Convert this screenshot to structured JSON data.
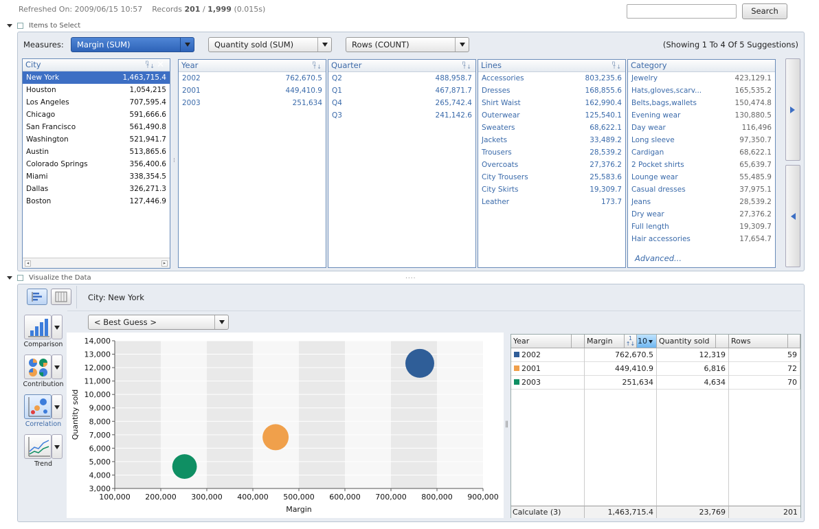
{
  "header": {
    "refreshed_label": "Refreshed On:",
    "refreshed_value": "2009/06/15 10:57",
    "records_label": "Records",
    "records_shown": "201",
    "records_sep": "/",
    "records_total": "1,999",
    "records_time": "(0.015s)",
    "search_placeholder": "",
    "search_button": "Search"
  },
  "items_section": {
    "title": "Items to Select",
    "measures_label": "Measures:",
    "measures": [
      {
        "label": "Margin (SUM)",
        "selected": true
      },
      {
        "label": "Quantity sold (SUM)",
        "selected": false
      },
      {
        "label": "Rows (COUNT)",
        "selected": false
      }
    ],
    "showing_text": "(Showing 1 To 4 Of 5 Suggestions)",
    "facets": {
      "city": {
        "title": "City",
        "rows": [
          {
            "name": "New York",
            "value": "1,463,715.4"
          },
          {
            "name": "Houston",
            "value": "1,054,215"
          },
          {
            "name": "Los Angeles",
            "value": "707,595.4"
          },
          {
            "name": "Chicago",
            "value": "591,666.6"
          },
          {
            "name": "San Francisco",
            "value": "561,490.8"
          },
          {
            "name": "Washington",
            "value": "521,941.7"
          },
          {
            "name": "Austin",
            "value": "513,865.6"
          },
          {
            "name": "Colorado Springs",
            "value": "356,400.6"
          },
          {
            "name": "Miami",
            "value": "338,354.5"
          },
          {
            "name": "Dallas",
            "value": "326,271.3"
          },
          {
            "name": "Boston",
            "value": "127,446.9"
          }
        ]
      },
      "year": {
        "title": "Year",
        "rows": [
          {
            "name": "2002",
            "value": "762,670.5"
          },
          {
            "name": "2001",
            "value": "449,410.9"
          },
          {
            "name": "2003",
            "value": "251,634"
          }
        ]
      },
      "quarter": {
        "title": "Quarter",
        "rows": [
          {
            "name": "Q2",
            "value": "488,958.7"
          },
          {
            "name": "Q1",
            "value": "467,871.7"
          },
          {
            "name": "Q4",
            "value": "265,742.4"
          },
          {
            "name": "Q3",
            "value": "241,142.6"
          }
        ]
      },
      "lines": {
        "title": "Lines",
        "rows": [
          {
            "name": "Accessories",
            "value": "803,235.6"
          },
          {
            "name": "Dresses",
            "value": "168,855.6"
          },
          {
            "name": "Shirt Waist",
            "value": "162,990.4"
          },
          {
            "name": "Outerwear",
            "value": "125,540.1"
          },
          {
            "name": "Sweaters",
            "value": "68,622.1"
          },
          {
            "name": "Jackets",
            "value": "33,489.2"
          },
          {
            "name": "Trousers",
            "value": "28,539.2"
          },
          {
            "name": "Overcoats",
            "value": "27,376.2"
          },
          {
            "name": "City Trousers",
            "value": "25,583.6"
          },
          {
            "name": "City Skirts",
            "value": "19,309.7"
          },
          {
            "name": "Leather",
            "value": "173.7"
          }
        ]
      },
      "category": {
        "title": "Category",
        "rows": [
          {
            "name": "Jewelry",
            "value": "423,129.1"
          },
          {
            "name": "Hats,gloves,scarv...",
            "value": "165,535.2"
          },
          {
            "name": "Belts,bags,wallets",
            "value": "150,474.8"
          },
          {
            "name": "Evening wear",
            "value": "130,880.5"
          },
          {
            "name": "Day wear",
            "value": "116,496"
          },
          {
            "name": "Long sleeve",
            "value": "97,350.7"
          },
          {
            "name": "Cardigan",
            "value": "68,622.1"
          },
          {
            "name": "2 Pocket shirts",
            "value": "65,639.7"
          },
          {
            "name": "Lounge wear",
            "value": "55,485.9"
          },
          {
            "name": "Casual dresses",
            "value": "37,975.1"
          },
          {
            "name": "Jeans",
            "value": "28,539.2"
          },
          {
            "name": "Dry wear",
            "value": "27,376.2"
          },
          {
            "name": "Full length",
            "value": "19,309.7"
          },
          {
            "name": "Hair accessories",
            "value": "17,654.7"
          }
        ],
        "advanced_link": "Advanced..."
      }
    }
  },
  "viz_section": {
    "title": "Visualize the Data",
    "filter_text": "City: New York",
    "best_guess": "< Best Guess >",
    "chart_types": [
      {
        "label": "Comparison",
        "icon": "bar-chart-icon"
      },
      {
        "label": "Contribution",
        "icon": "pie-chart-icon"
      },
      {
        "label": "Correlation",
        "icon": "bubble-chart-icon"
      },
      {
        "label": "Trend",
        "icon": "line-chart-icon"
      }
    ],
    "table": {
      "headers": [
        "Year",
        "Margin",
        "Quantity sold",
        "Rows"
      ],
      "topn_value": "10",
      "rows": [
        {
          "year": "2002",
          "color": "#2f5e98",
          "margin": "762,670.5",
          "qty": "12,319",
          "rows": "59"
        },
        {
          "year": "2001",
          "color": "#f0a04b",
          "margin": "449,410.9",
          "qty": "6,816",
          "rows": "72"
        },
        {
          "year": "2003",
          "color": "#0f8f63",
          "margin": "251,634",
          "qty": "4,634",
          "rows": "70"
        }
      ],
      "footer": {
        "label": "Calculate (3)",
        "margin": "1,463,715.4",
        "qty": "23,769",
        "rows": "201"
      }
    }
  },
  "chart_data": {
    "type": "scatter",
    "xlabel": "Margin",
    "ylabel": "Quantity sold",
    "xlim": [
      100000,
      900000
    ],
    "ylim": [
      3000,
      14000
    ],
    "x_ticks": [
      "100,000",
      "200,000",
      "300,000",
      "400,000",
      "500,000",
      "600,000",
      "700,000",
      "800,000",
      "900,000"
    ],
    "y_ticks": [
      "14,000",
      "13,000",
      "12,000",
      "11,000",
      "10,000",
      "9,000",
      "8,000",
      "7,000",
      "6,000",
      "5,000",
      "4,000",
      "3,000"
    ],
    "grid": true,
    "series": [
      {
        "name": "2002",
        "color": "#2f5e98",
        "x": 762670.5,
        "y": 12319
      },
      {
        "name": "2001",
        "color": "#f0a04b",
        "x": 449410.9,
        "y": 6816
      },
      {
        "name": "2003",
        "color": "#0f8f63",
        "x": 251634,
        "y": 4634
      }
    ]
  }
}
